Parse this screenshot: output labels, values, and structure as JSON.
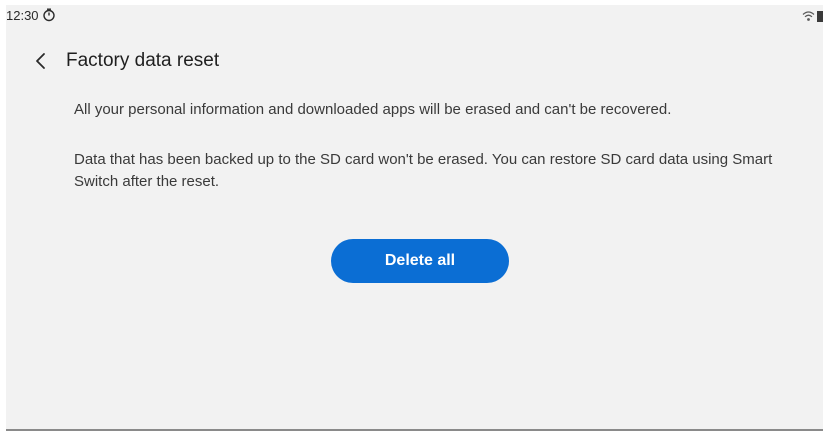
{
  "status_bar": {
    "time": "12:30",
    "icons": [
      "timer-icon",
      "wifi-icon",
      "battery-icon"
    ]
  },
  "header": {
    "back_icon": "chevron-left-icon",
    "title": "Factory data reset"
  },
  "content": {
    "paragraph_1": "All your personal information and downloaded apps will be erased and can't be recovered.",
    "paragraph_2": "Data that has been backed up to the SD card won't be erased. You can restore SD card data using Smart Switch after the reset."
  },
  "actions": {
    "delete_all_label": "Delete all"
  },
  "colors": {
    "background": "#f2f2f2",
    "accent": "#0b6ed4",
    "title_text": "#1f1f1f",
    "body_text": "#3a3a3a"
  }
}
